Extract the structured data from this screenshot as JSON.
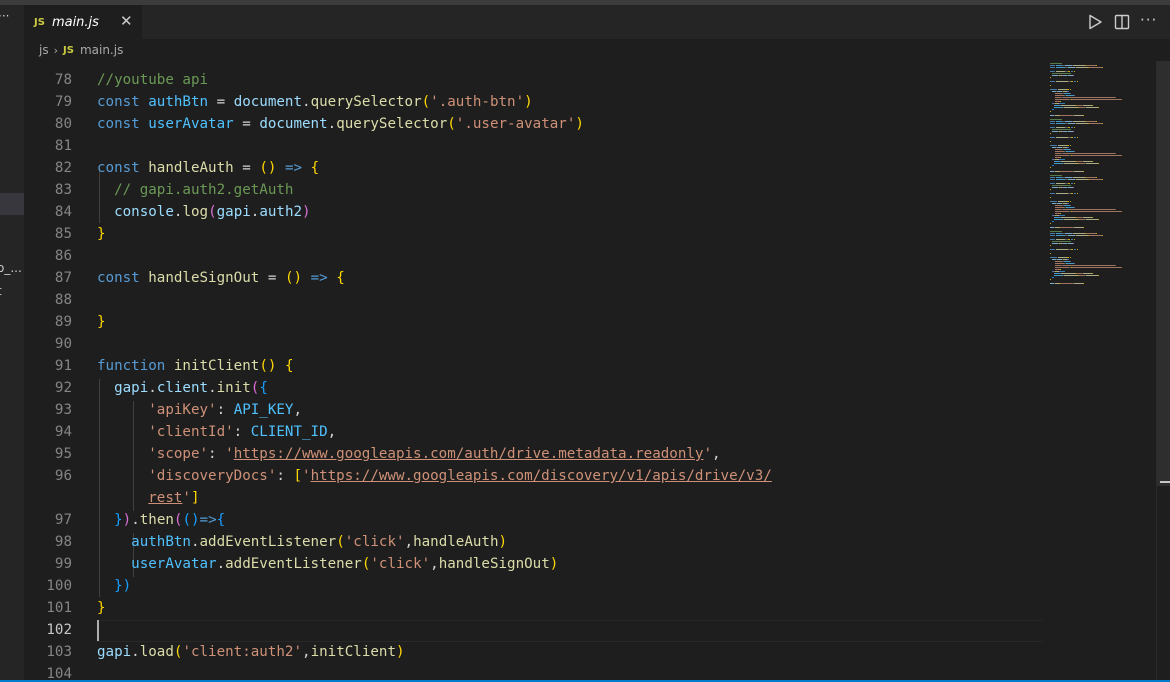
{
  "left_panel": {
    "items": [
      "o_...",
      "t"
    ]
  },
  "tabs": [
    {
      "badge": "JS",
      "label": "main.js",
      "close": "✕"
    }
  ],
  "breadcrumb": {
    "folder": "js",
    "separator": "›",
    "badge": "JS",
    "file": "main.js"
  },
  "editor_actions": [
    "play-icon",
    "split-editor-icon",
    "more-actions-icon"
  ],
  "colors": {
    "keyword": "#569cd6",
    "string": "#ce9178",
    "comment": "#6a9955",
    "function": "#dcdcaa",
    "variable": "#9cdcfe",
    "constant": "#4fc1ff",
    "accent": "#007acc"
  },
  "editor": {
    "current_line": "102",
    "lines": [
      {
        "no": "78",
        "tokens": [
          {
            "t": "//youtube api",
            "c": "cm"
          }
        ]
      },
      {
        "no": "79",
        "tokens": [
          {
            "t": "const",
            "c": "k"
          },
          {
            "t": " ",
            "c": "p"
          },
          {
            "t": "authBtn",
            "c": "c"
          },
          {
            "t": " = ",
            "c": "p"
          },
          {
            "t": "document",
            "c": "v"
          },
          {
            "t": ".",
            "c": "p"
          },
          {
            "t": "querySelector",
            "c": "f"
          },
          {
            "t": "(",
            "c": "b1"
          },
          {
            "t": "'.auth-btn'",
            "c": "s"
          },
          {
            "t": ")",
            "c": "b1"
          }
        ]
      },
      {
        "no": "80",
        "tokens": [
          {
            "t": "const",
            "c": "k"
          },
          {
            "t": " ",
            "c": "p"
          },
          {
            "t": "userAvatar",
            "c": "c"
          },
          {
            "t": " = ",
            "c": "p"
          },
          {
            "t": "document",
            "c": "v"
          },
          {
            "t": ".",
            "c": "p"
          },
          {
            "t": "querySelector",
            "c": "f"
          },
          {
            "t": "(",
            "c": "b1"
          },
          {
            "t": "'.user-avatar'",
            "c": "s"
          },
          {
            "t": ")",
            "c": "b1"
          }
        ]
      },
      {
        "no": "81",
        "tokens": []
      },
      {
        "no": "82",
        "tokens": [
          {
            "t": "const",
            "c": "k"
          },
          {
            "t": " ",
            "c": "p"
          },
          {
            "t": "handleAuth",
            "c": "f"
          },
          {
            "t": " = ",
            "c": "p"
          },
          {
            "t": "()",
            "c": "b1"
          },
          {
            "t": " ",
            "c": "p"
          },
          {
            "t": "=>",
            "c": "k"
          },
          {
            "t": " ",
            "c": "p"
          },
          {
            "t": "{",
            "c": "b1"
          }
        ]
      },
      {
        "no": "83",
        "tokens": [
          {
            "t": "  ",
            "c": "p"
          },
          {
            "t": "// gapi.auth2.getAuth",
            "c": "cm"
          }
        ]
      },
      {
        "no": "84",
        "tokens": [
          {
            "t": "  ",
            "c": "p"
          },
          {
            "t": "console",
            "c": "v"
          },
          {
            "t": ".",
            "c": "p"
          },
          {
            "t": "log",
            "c": "f"
          },
          {
            "t": "(",
            "c": "b2"
          },
          {
            "t": "gapi",
            "c": "v"
          },
          {
            "t": ".",
            "c": "p"
          },
          {
            "t": "auth2",
            "c": "v"
          },
          {
            "t": ")",
            "c": "b2"
          }
        ]
      },
      {
        "no": "85",
        "tokens": [
          {
            "t": "}",
            "c": "b1"
          }
        ]
      },
      {
        "no": "86",
        "tokens": []
      },
      {
        "no": "87",
        "tokens": [
          {
            "t": "const",
            "c": "k"
          },
          {
            "t": " ",
            "c": "p"
          },
          {
            "t": "handleSignOut",
            "c": "f"
          },
          {
            "t": " = ",
            "c": "p"
          },
          {
            "t": "()",
            "c": "b1"
          },
          {
            "t": " ",
            "c": "p"
          },
          {
            "t": "=>",
            "c": "k"
          },
          {
            "t": " ",
            "c": "p"
          },
          {
            "t": "{",
            "c": "b1"
          }
        ]
      },
      {
        "no": "88",
        "tokens": []
      },
      {
        "no": "89",
        "tokens": [
          {
            "t": "}",
            "c": "b1"
          }
        ]
      },
      {
        "no": "90",
        "tokens": []
      },
      {
        "no": "91",
        "tokens": [
          {
            "t": "function",
            "c": "k"
          },
          {
            "t": " ",
            "c": "p"
          },
          {
            "t": "initClient",
            "c": "f"
          },
          {
            "t": "()",
            "c": "b1"
          },
          {
            "t": " ",
            "c": "p"
          },
          {
            "t": "{",
            "c": "b1"
          }
        ]
      },
      {
        "no": "92",
        "tokens": [
          {
            "t": "  ",
            "c": "p"
          },
          {
            "t": "gapi",
            "c": "v"
          },
          {
            "t": ".",
            "c": "p"
          },
          {
            "t": "client",
            "c": "v"
          },
          {
            "t": ".",
            "c": "p"
          },
          {
            "t": "init",
            "c": "f"
          },
          {
            "t": "(",
            "c": "b2"
          },
          {
            "t": "{",
            "c": "b3"
          }
        ]
      },
      {
        "no": "93",
        "tokens": [
          {
            "t": "      ",
            "c": "p"
          },
          {
            "t": "'apiKey'",
            "c": "s"
          },
          {
            "t": ": ",
            "c": "p"
          },
          {
            "t": "API_KEY",
            "c": "c"
          },
          {
            "t": ",",
            "c": "p"
          }
        ]
      },
      {
        "no": "94",
        "tokens": [
          {
            "t": "      ",
            "c": "p"
          },
          {
            "t": "'clientId'",
            "c": "s"
          },
          {
            "t": ": ",
            "c": "p"
          },
          {
            "t": "CLIENT_ID",
            "c": "c"
          },
          {
            "t": ",",
            "c": "p"
          }
        ]
      },
      {
        "no": "95",
        "tokens": [
          {
            "t": "      ",
            "c": "p"
          },
          {
            "t": "'scope'",
            "c": "s"
          },
          {
            "t": ": ",
            "c": "p"
          },
          {
            "t": "'",
            "c": "s"
          },
          {
            "t": "https://www.googleapis.com/auth/drive.metadata.readonly",
            "c": "s u"
          },
          {
            "t": "'",
            "c": "s"
          },
          {
            "t": ",",
            "c": "p"
          }
        ]
      },
      {
        "no": "96",
        "tokens": [
          {
            "t": "      ",
            "c": "p"
          },
          {
            "t": "'discoveryDocs'",
            "c": "s"
          },
          {
            "t": ": ",
            "c": "p"
          },
          {
            "t": "[",
            "c": "b1"
          },
          {
            "t": "'",
            "c": "s"
          },
          {
            "t": "https://www.googleapis.com/discovery/v1/apis/drive/v3/",
            "c": "s u"
          }
        ]
      },
      {
        "no": "",
        "tokens": [
          {
            "t": "      ",
            "c": "p"
          },
          {
            "t": "rest",
            "c": "s u"
          },
          {
            "t": "'",
            "c": "s"
          },
          {
            "t": "]",
            "c": "b1"
          }
        ]
      },
      {
        "no": "97",
        "tokens": [
          {
            "t": "  ",
            "c": "p"
          },
          {
            "t": "}",
            "c": "b3"
          },
          {
            "t": ")",
            "c": "b2"
          },
          {
            "t": ".",
            "c": "p"
          },
          {
            "t": "then",
            "c": "f"
          },
          {
            "t": "(",
            "c": "b2"
          },
          {
            "t": "()",
            "c": "b3"
          },
          {
            "t": "=>",
            "c": "k"
          },
          {
            "t": "{",
            "c": "b3"
          }
        ]
      },
      {
        "no": "98",
        "tokens": [
          {
            "t": "    ",
            "c": "p"
          },
          {
            "t": "authBtn",
            "c": "c"
          },
          {
            "t": ".",
            "c": "p"
          },
          {
            "t": "addEventListener",
            "c": "f"
          },
          {
            "t": "(",
            "c": "b1"
          },
          {
            "t": "'click'",
            "c": "s"
          },
          {
            "t": ",",
            "c": "p"
          },
          {
            "t": "handleAuth",
            "c": "f"
          },
          {
            "t": ")",
            "c": "b1"
          }
        ]
      },
      {
        "no": "99",
        "tokens": [
          {
            "t": "    ",
            "c": "p"
          },
          {
            "t": "userAvatar",
            "c": "c"
          },
          {
            "t": ".",
            "c": "p"
          },
          {
            "t": "addEventListener",
            "c": "f"
          },
          {
            "t": "(",
            "c": "b1"
          },
          {
            "t": "'click'",
            "c": "s"
          },
          {
            "t": ",",
            "c": "p"
          },
          {
            "t": "handleSignOut",
            "c": "f"
          },
          {
            "t": ")",
            "c": "b1"
          }
        ]
      },
      {
        "no": "100",
        "tokens": [
          {
            "t": "  ",
            "c": "p"
          },
          {
            "t": "})",
            "c": "b3"
          }
        ]
      },
      {
        "no": "101",
        "tokens": [
          {
            "t": "}",
            "c": "b1"
          }
        ]
      },
      {
        "no": "102",
        "tokens": []
      },
      {
        "no": "103",
        "tokens": [
          {
            "t": "gapi",
            "c": "v"
          },
          {
            "t": ".",
            "c": "p"
          },
          {
            "t": "load",
            "c": "f"
          },
          {
            "t": "(",
            "c": "b1"
          },
          {
            "t": "'client:auth2'",
            "c": "s"
          },
          {
            "t": ",",
            "c": "p"
          },
          {
            "t": "initClient",
            "c": "f"
          },
          {
            "t": ")",
            "c": "b1"
          }
        ]
      },
      {
        "no": "104",
        "tokens": []
      }
    ]
  }
}
